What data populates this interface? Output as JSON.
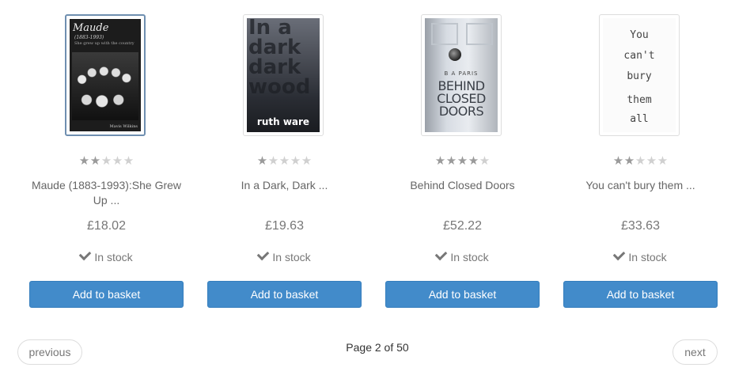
{
  "products": [
    {
      "title": "Maude (1883-1993):She Grew Up ...",
      "rating": 2,
      "price": "£18.02",
      "availability": "In stock",
      "button_label": "Add to basket",
      "cover": {
        "title": "Maude",
        "subtitle": "(1883-1993)",
        "tagline": "She grew up with the country",
        "author": "Mavis Wilkins"
      }
    },
    {
      "title": "In a Dark, Dark ...",
      "rating": 1,
      "price": "£19.63",
      "availability": "In stock",
      "button_label": "Add to basket",
      "cover": {
        "title": "In a dark dark wood",
        "author": "ruth ware"
      }
    },
    {
      "title": "Behind Closed Doors",
      "rating": 4,
      "price": "£52.22",
      "availability": "In stock",
      "button_label": "Add to basket",
      "cover": {
        "author": "B A PARIS",
        "title_line1": "BEHIND",
        "title_line2": "CLOSED",
        "title_line3": "DOORS"
      }
    },
    {
      "title": "You can't bury them ...",
      "rating": 2,
      "price": "£33.63",
      "availability": "In stock",
      "button_label": "Add to basket",
      "cover": {
        "w1": "You",
        "w2": "can't",
        "w3": "bury",
        "w4": "them",
        "w5": "all"
      }
    }
  ],
  "pager": {
    "previous_label": "previous",
    "current": "Page 2 of 50",
    "next_label": "next"
  },
  "colors": {
    "button": "#428bca",
    "star_on": "#9a9a9a",
    "star_off": "#d0d0d0"
  }
}
